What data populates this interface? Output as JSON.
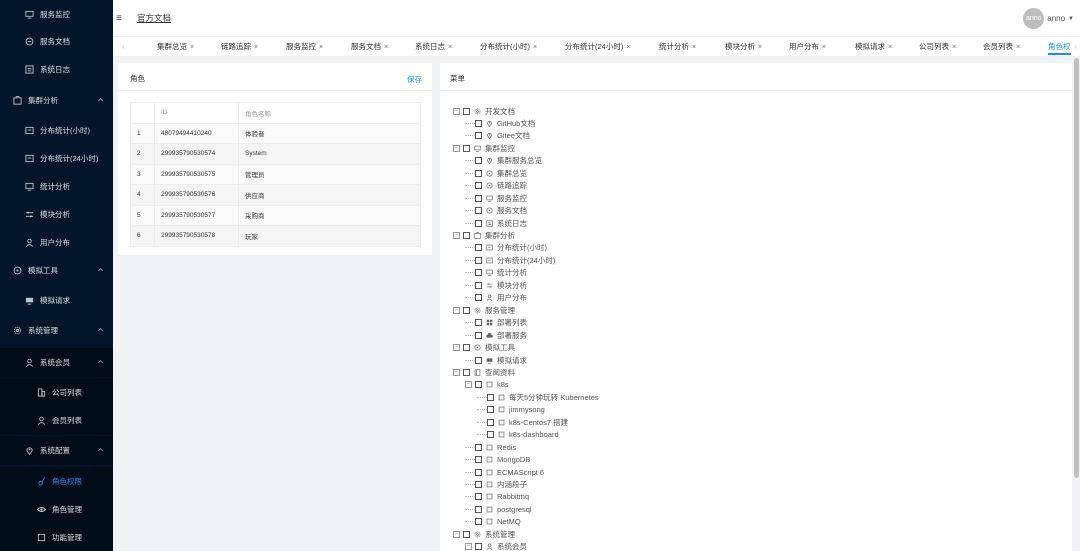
{
  "sidebar": {
    "items": [
      {
        "label": "服务监控",
        "icon": "monitor-icon",
        "level": "lv1"
      },
      {
        "label": "服务文档",
        "icon": "doc-icon",
        "level": "lv1"
      },
      {
        "label": "系统日志",
        "icon": "log-icon",
        "level": "lv1"
      },
      {
        "label": "集群分析",
        "icon": "cluster-icon",
        "level": "lv0",
        "arrow": true
      },
      {
        "label": "分布统计(小时)",
        "icon": "chart-icon",
        "level": "lv1"
      },
      {
        "label": "分布统计(24小时)",
        "icon": "chart-icon",
        "level": "lv1"
      },
      {
        "label": "统计分析",
        "icon": "monitor-icon",
        "level": "lv1"
      },
      {
        "label": "模块分析",
        "icon": "sliders-icon",
        "level": "lv1"
      },
      {
        "label": "用户分布",
        "icon": "user-icon",
        "level": "lv1"
      },
      {
        "label": "模拟工具",
        "icon": "tool-icon",
        "level": "lv0",
        "arrow": true
      },
      {
        "label": "模拟请求",
        "icon": "request-icon",
        "level": "lv1"
      },
      {
        "label": "系统管理",
        "icon": "settings-icon",
        "level": "lv0",
        "arrow": true
      },
      {
        "label": "系统会员",
        "icon": "user-icon",
        "level": "lv2",
        "arrow": true
      },
      {
        "label": "公司列表",
        "icon": "building-icon",
        "level": "lv3"
      },
      {
        "label": "会员列表",
        "icon": "user-icon",
        "level": "lv3"
      },
      {
        "label": "系统配置",
        "icon": "location-icon",
        "level": "lv2",
        "arrow": true
      },
      {
        "label": "角色权限",
        "icon": "key-icon",
        "level": "lv3",
        "active": true
      },
      {
        "label": "角色管理",
        "icon": "eye-icon",
        "level": "lv3"
      },
      {
        "label": "功能管理",
        "icon": "square-icon",
        "level": "lv3"
      }
    ]
  },
  "header": {
    "menu_icon": "≡",
    "breadcrumb": "官方文档",
    "avatar_text": "anno",
    "username": "anno",
    "caret": "▼"
  },
  "tabs": {
    "prev": "‹",
    "next": "›",
    "close_glyph": "×",
    "items": [
      {
        "label": "集群总览"
      },
      {
        "label": "链路追踪"
      },
      {
        "label": "服务监控"
      },
      {
        "label": "服务文档"
      },
      {
        "label": "系统日志"
      },
      {
        "label": "分布统计(小时)"
      },
      {
        "label": "分布统计(24小时)"
      },
      {
        "label": "统计分析"
      },
      {
        "label": "模块分析"
      },
      {
        "label": "用户分布"
      },
      {
        "label": "模拟请求"
      },
      {
        "label": "公司列表"
      },
      {
        "label": "会员列表"
      },
      {
        "label": "角色权",
        "active": true
      }
    ]
  },
  "roles_panel": {
    "title": "角色",
    "save": "保存",
    "columns": [
      "",
      "ID",
      "角色名称"
    ],
    "rows": [
      [
        "1",
        "48079494410240",
        "体验者"
      ],
      [
        "2",
        "299935790530574",
        "System"
      ],
      [
        "3",
        "299935790530575",
        "管理员"
      ],
      [
        "4",
        "299935790530576",
        "供应商"
      ],
      [
        "5",
        "299935790530577",
        "采购商"
      ],
      [
        "6",
        "299935790530578",
        "玩家"
      ]
    ]
  },
  "menu_panel": {
    "title": "菜单",
    "tree": [
      {
        "label": "开发文档",
        "icon": "settings-icon",
        "depth": 0,
        "toggle": "⊟"
      },
      {
        "label": "GitHub文档",
        "icon": "location-icon",
        "depth": 1
      },
      {
        "label": "Gitee文档",
        "icon": "location-icon",
        "depth": 1
      },
      {
        "label": "集群监控",
        "icon": "monitor-icon",
        "depth": 0,
        "toggle": "⊟"
      },
      {
        "label": "集群服务总览",
        "icon": "location-icon",
        "depth": 1
      },
      {
        "label": "集群总览",
        "icon": "tool-icon",
        "depth": 1
      },
      {
        "label": "链路追踪",
        "icon": "tool-icon",
        "depth": 1
      },
      {
        "label": "服务监控",
        "icon": "monitor-icon",
        "depth": 1
      },
      {
        "label": "服务文档",
        "icon": "tool-icon",
        "depth": 1
      },
      {
        "label": "系统日志",
        "icon": "log-icon",
        "depth": 1
      },
      {
        "label": "集群分析",
        "icon": "cluster-icon",
        "depth": 0,
        "toggle": "⊟"
      },
      {
        "label": "分布统计(小时)",
        "icon": "chart-icon",
        "depth": 1
      },
      {
        "label": "分布统计(24小时)",
        "icon": "chart-icon",
        "depth": 1
      },
      {
        "label": "统计分析",
        "icon": "monitor-icon",
        "depth": 1
      },
      {
        "label": "模块分析",
        "icon": "sliders-icon",
        "depth": 1
      },
      {
        "label": "用户分布",
        "icon": "user-icon",
        "depth": 1
      },
      {
        "label": "服务管理",
        "icon": "settings-icon",
        "depth": 0,
        "toggle": "⊟"
      },
      {
        "label": "部署列表",
        "icon": "grid-icon",
        "depth": 1
      },
      {
        "label": "部署服务",
        "icon": "cloud-icon",
        "depth": 1
      },
      {
        "label": "模拟工具",
        "icon": "tool-icon",
        "depth": 0,
        "toggle": "⊟"
      },
      {
        "label": "模拟请求",
        "icon": "request-icon",
        "depth": 1
      },
      {
        "label": "查阅资料",
        "icon": "book-icon",
        "depth": 0,
        "toggle": "⊟"
      },
      {
        "label": "k8s",
        "icon": "square-icon",
        "depth": 1,
        "toggle": "⊟"
      },
      {
        "label": "每天5分钟玩转 Kubernetes",
        "icon": "square-icon",
        "depth": 2
      },
      {
        "label": "jimmysong",
        "icon": "square-icon",
        "depth": 2
      },
      {
        "label": "k8s-Centos7 搭建",
        "icon": "square-icon",
        "depth": 2
      },
      {
        "label": "k8s-dashboard",
        "icon": "square-icon",
        "depth": 2
      },
      {
        "label": "Redis",
        "icon": "square-icon",
        "depth": 1
      },
      {
        "label": "MongoDB",
        "icon": "square-icon",
        "depth": 1
      },
      {
        "label": "ECMAScript 6",
        "icon": "square-icon",
        "depth": 1
      },
      {
        "label": "内涵段子",
        "icon": "square-icon",
        "depth": 1
      },
      {
        "label": "Rabbitmq",
        "icon": "square-icon",
        "depth": 1
      },
      {
        "label": "postgresql",
        "icon": "square-icon",
        "depth": 1
      },
      {
        "label": "NetMQ",
        "icon": "square-icon",
        "depth": 1
      },
      {
        "label": "系统管理",
        "icon": "settings-icon",
        "depth": 0,
        "toggle": "⊟"
      },
      {
        "label": "系统会员",
        "icon": "user-icon",
        "depth": 1,
        "toggle": "⊟"
      }
    ]
  },
  "colors": {
    "accent": "#1890ff",
    "sidebar_bg": "#001529"
  }
}
